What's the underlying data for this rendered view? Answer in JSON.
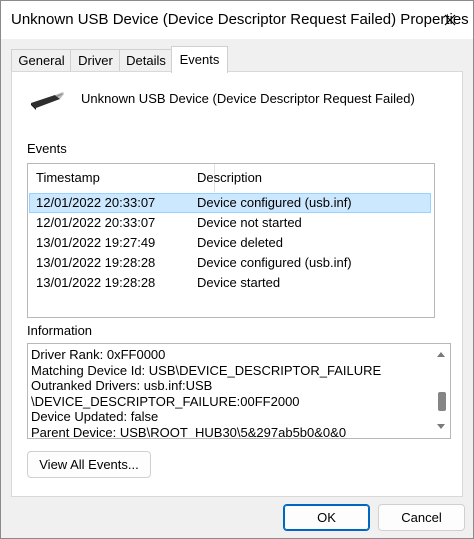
{
  "window": {
    "title": "Unknown USB Device (Device Descriptor Request Failed) Properties"
  },
  "tabs": [
    {
      "label": "General"
    },
    {
      "label": "Driver"
    },
    {
      "label": "Details"
    },
    {
      "label": "Events"
    }
  ],
  "device": {
    "icon": "usb-connector-icon",
    "name": "Unknown USB Device (Device Descriptor Request Failed)"
  },
  "events": {
    "label": "Events",
    "columns": {
      "timestamp": "Timestamp",
      "description": "Description"
    },
    "rows": [
      {
        "timestamp": "12/01/2022 20:33:07",
        "description": "Device configured (usb.inf)"
      },
      {
        "timestamp": "12/01/2022 20:33:07",
        "description": "Device not started"
      },
      {
        "timestamp": "13/01/2022 19:27:49",
        "description": "Device deleted"
      },
      {
        "timestamp": "13/01/2022 19:28:28",
        "description": "Device configured (usb.inf)"
      },
      {
        "timestamp": "13/01/2022 19:28:28",
        "description": "Device started"
      }
    ],
    "selected_index": 0
  },
  "information": {
    "label": "Information",
    "lines": [
      "Driver Rank: 0xFF0000",
      "Matching Device Id: USB\\DEVICE_DESCRIPTOR_FAILURE",
      "Outranked Drivers: usb.inf:USB",
      "\\DEVICE_DESCRIPTOR_FAILURE:00FF2000",
      "Device Updated: false",
      "Parent Device: USB\\ROOT_HUB30\\5&297ab5b0&0&0"
    ]
  },
  "buttons": {
    "view_all": "View All Events...",
    "ok": "OK",
    "cancel": "Cancel"
  },
  "colors": {
    "selection": "#cce8ff",
    "accent": "#0067c0"
  }
}
